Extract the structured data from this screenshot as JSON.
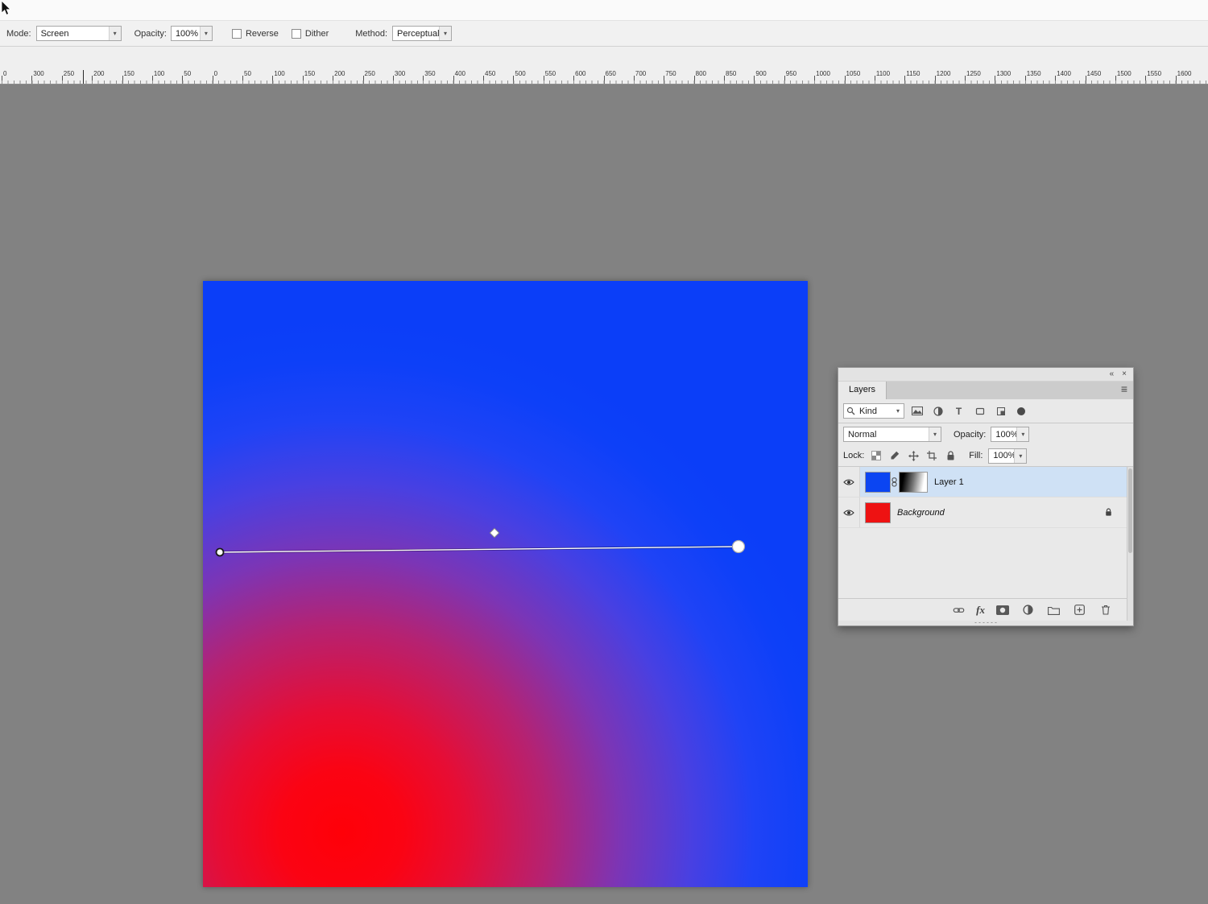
{
  "options_bar": {
    "mode_label": "Mode:",
    "mode_value": "Screen",
    "opacity_label": "Opacity:",
    "opacity_value": "100%",
    "reverse_label": "Reverse",
    "dither_label": "Dither",
    "method_label": "Method:",
    "method_value": "Perceptual"
  },
  "ruler": {
    "labels": [
      "0",
      "300",
      "250",
      "200",
      "150",
      "100",
      "50",
      "0",
      "50",
      "100",
      "150",
      "200",
      "250",
      "300",
      "350",
      "400",
      "450",
      "500",
      "550",
      "600",
      "650",
      "700",
      "750",
      "800",
      "850",
      "900",
      "950",
      "1000",
      "1050",
      "1100",
      "1150",
      "1200",
      "1250",
      "1300",
      "1350",
      "1400",
      "1450",
      "1500",
      "1550",
      "1600"
    ]
  },
  "layers_panel": {
    "title": "Layers",
    "filter_kind": "Kind",
    "blend_mode": "Normal",
    "opacity_label": "Opacity:",
    "opacity_value": "100%",
    "lock_label": "Lock:",
    "fill_label": "Fill:",
    "fill_value": "100%",
    "layers": [
      {
        "name": "Layer 1",
        "selected": true,
        "visible": true
      },
      {
        "name": "Background",
        "locked": true,
        "visible": true
      }
    ]
  },
  "icons": {
    "chevron_down": "▾",
    "collapse": "«",
    "close": "×",
    "menu": "≡",
    "fx": "fx",
    "type": "T"
  },
  "colors": {
    "workspace": "#828282",
    "selected_layer_row": "#cfe1f5",
    "canvas_blue": "#0b3ef8",
    "canvas_red": "#ff0008",
    "layer1_thumbnail": "#0b45f2",
    "background_thumbnail": "#ee1212"
  }
}
